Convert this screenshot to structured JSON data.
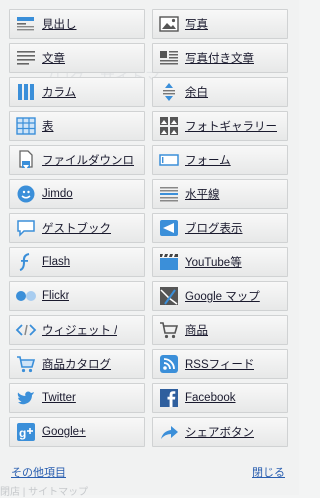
{
  "items": [
    {
      "label": "見出し",
      "icon": "heading-icon"
    },
    {
      "label": "写真",
      "icon": "photo-icon"
    },
    {
      "label": "文章",
      "icon": "text-icon"
    },
    {
      "label": "写真付き文章",
      "icon": "text-with-photo-icon"
    },
    {
      "label": "カラム",
      "icon": "columns-icon"
    },
    {
      "label": "余白",
      "icon": "spacing-icon"
    },
    {
      "label": "表",
      "icon": "table-icon"
    },
    {
      "label": "フォトギャラリー",
      "icon": "photo-gallery-icon"
    },
    {
      "label": "ファイルダウンロ",
      "icon": "file-download-icon"
    },
    {
      "label": "フォーム",
      "icon": "form-icon"
    },
    {
      "label": "Jimdo",
      "icon": "jimdo-icon"
    },
    {
      "label": "水平線",
      "icon": "horizontal-line-icon"
    },
    {
      "label": "ゲストブック",
      "icon": "guestbook-icon"
    },
    {
      "label": "ブログ表示",
      "icon": "blog-display-icon"
    },
    {
      "label": "Flash",
      "icon": "flash-icon"
    },
    {
      "label": "YouTube等",
      "icon": "video-icon"
    },
    {
      "label": "Flickr",
      "icon": "flickr-icon"
    },
    {
      "label": "Google マップ",
      "icon": "google-map-icon"
    },
    {
      "label": "ウィジェット /",
      "icon": "widget-icon"
    },
    {
      "label": "商品",
      "icon": "product-icon"
    },
    {
      "label": "商品カタログ",
      "icon": "product-catalog-icon"
    },
    {
      "label": "RSSフィード",
      "icon": "rss-icon"
    },
    {
      "label": "Twitter",
      "icon": "twitter-icon"
    },
    {
      "label": "Facebook",
      "icon": "facebook-icon"
    },
    {
      "label": "Google+",
      "icon": "google-plus-icon"
    },
    {
      "label": "シェアボタン",
      "icon": "share-button-icon"
    }
  ],
  "footer": {
    "other_items": "その他項目",
    "close": "閉じる"
  },
  "background_text": {
    "top": "ブログ　サイトマ",
    "bottom": "閉店 | サイトマップ"
  }
}
